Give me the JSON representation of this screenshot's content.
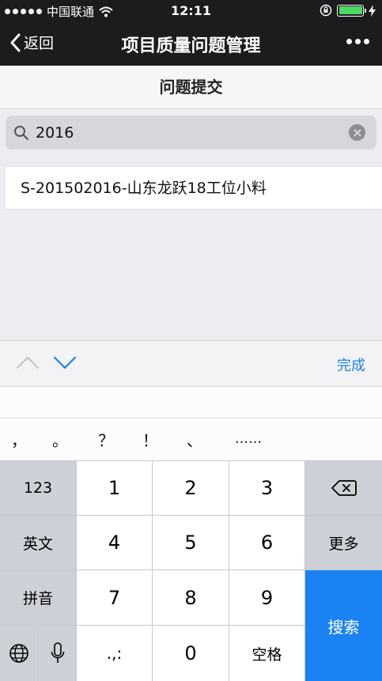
{
  "statusbar": {
    "carrier": "中国联通",
    "time": "12:11"
  },
  "nav": {
    "back_label": "返回",
    "title": "项目质量问题管理"
  },
  "page": {
    "header": "问题提交"
  },
  "search": {
    "value": "2016"
  },
  "results": [
    {
      "label": "S-201502016-山东龙跃18工位小料"
    }
  ],
  "accessory": {
    "done_label": "完成"
  },
  "punctuation": [
    "，",
    "。",
    "？",
    "！",
    "、",
    "……"
  ],
  "keyboard": {
    "k123": "123",
    "k1": "1",
    "k2": "2",
    "k3": "3",
    "k4": "4",
    "k5": "5",
    "k6": "6",
    "k7": "7",
    "k8": "8",
    "k9": "9",
    "k0": "0",
    "english": "英文",
    "pinyin": "拼音",
    "more": "更多",
    "dot_keys": ".,:",
    "space": "空格",
    "search": "搜索"
  },
  "colors": {
    "accent": "#1a82f2",
    "battery": "#4cd964",
    "nav_bg": "#1c1c1f"
  }
}
